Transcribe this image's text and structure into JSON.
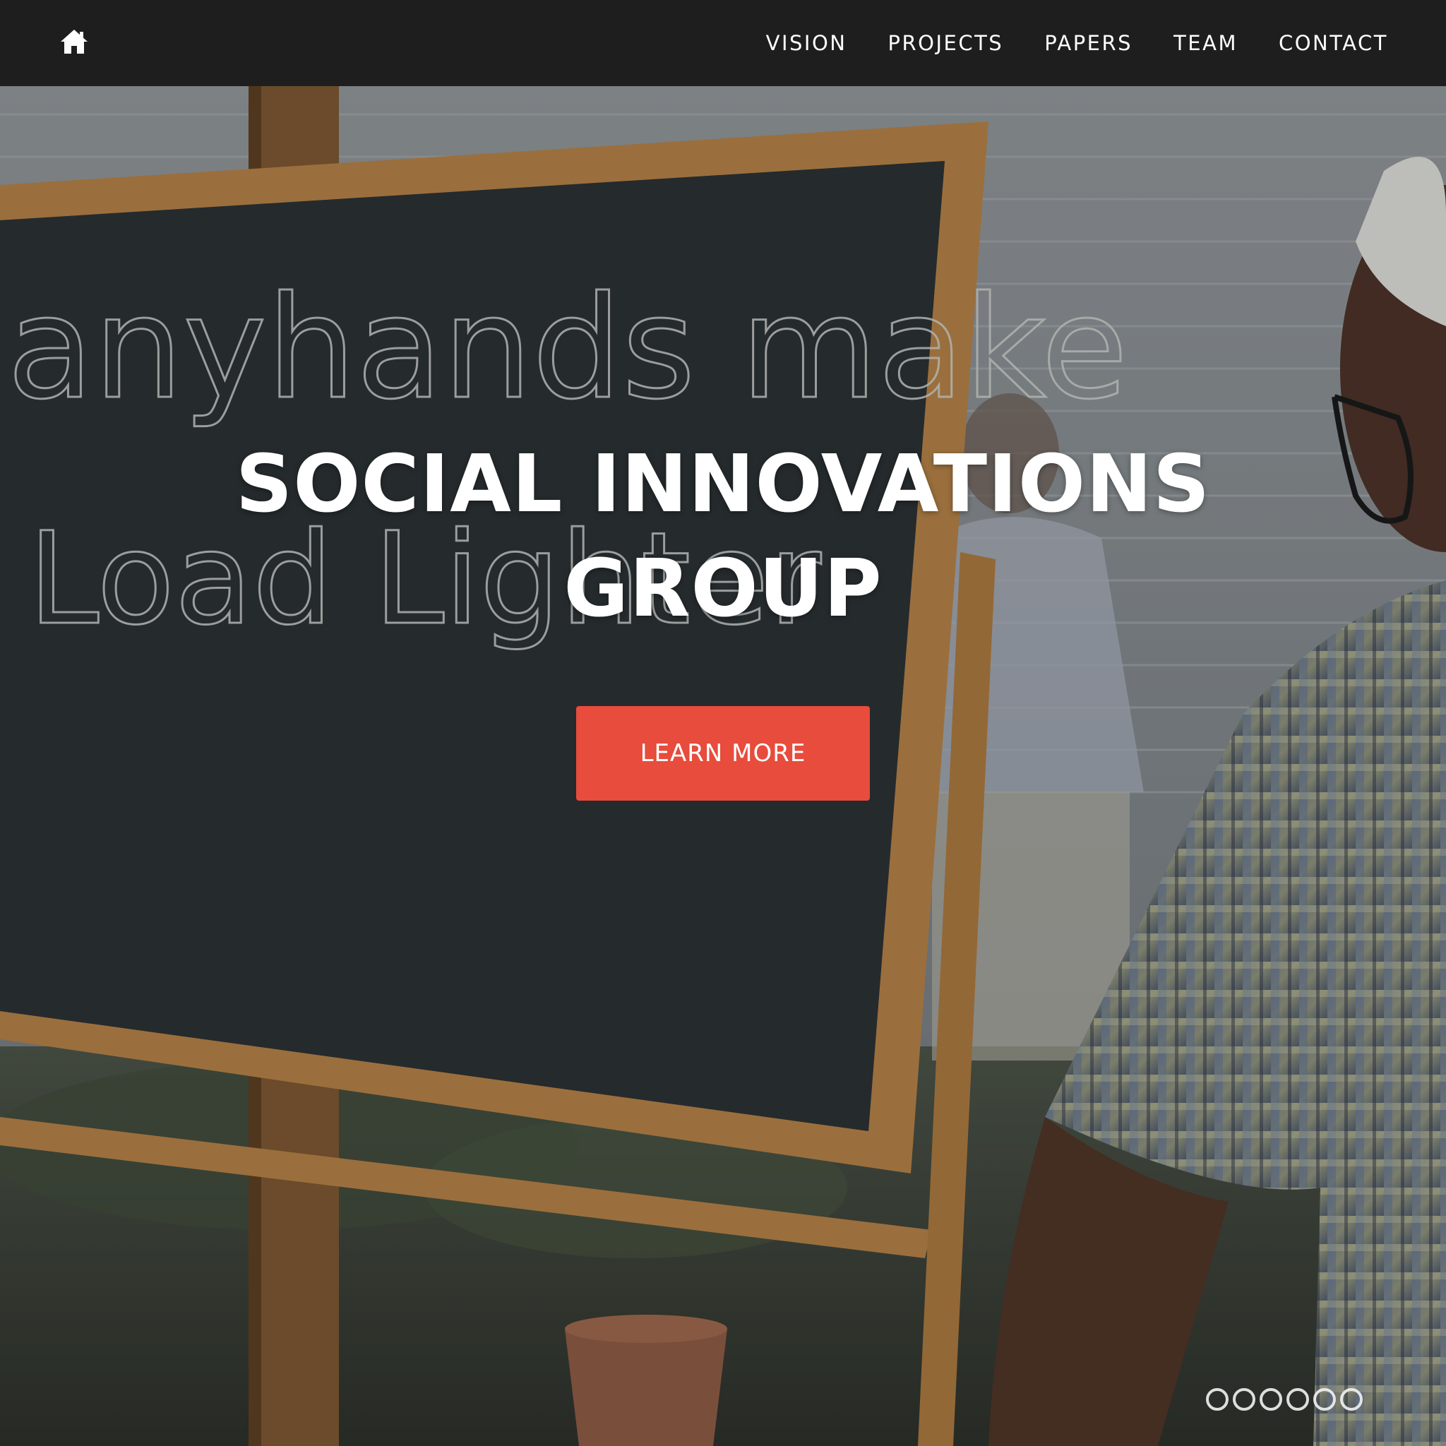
{
  "nav": {
    "home_icon": "home-icon",
    "links": [
      {
        "label": "VISION"
      },
      {
        "label": "PROJECTS"
      },
      {
        "label": "PAPERS"
      },
      {
        "label": "TEAM"
      },
      {
        "label": "CONTACT"
      }
    ]
  },
  "hero": {
    "title_line1": "SOCIAL INNOVATIONS",
    "title_line2": "GROUP",
    "cta_label": "LEARN MORE",
    "chalkboard_line1": "anyhands make",
    "chalkboard_line2": "Load Lighter",
    "slide_count": 6,
    "accent_color": "#e74c3c"
  }
}
